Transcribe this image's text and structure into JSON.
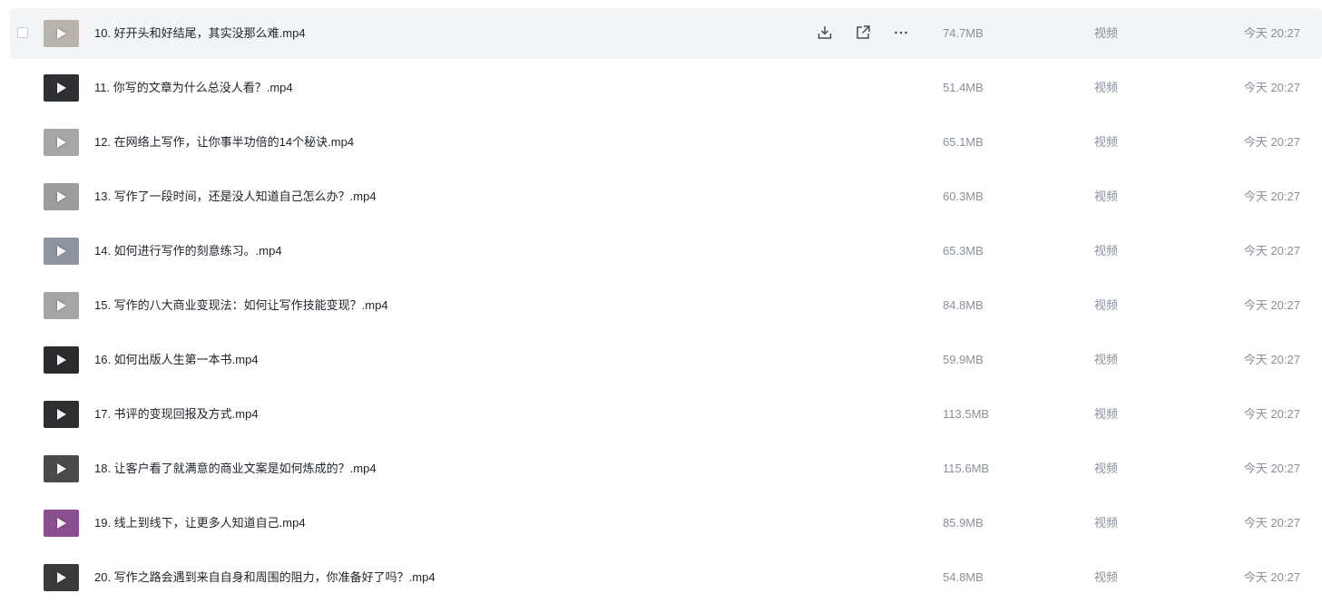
{
  "columns": {
    "type_label": "视频"
  },
  "row_actions": {
    "download_icon": "download-icon",
    "share_icon": "share-icon",
    "more_icon": "more-icon"
  },
  "files": [
    {
      "name": "10. 好开头和好结尾，其实没那么难.mp4",
      "size": "74.7MB",
      "type": "视频",
      "time": "今天 20:27",
      "thumb": "#b9b3ad"
    },
    {
      "name": "11. 你写的文章为什么总没人看？.mp4",
      "size": "51.4MB",
      "type": "视频",
      "time": "今天 20:27",
      "thumb": "#2f3033"
    },
    {
      "name": "12. 在网络上写作，让你事半功倍的14个秘诀.mp4",
      "size": "65.1MB",
      "type": "视频",
      "time": "今天 20:27",
      "thumb": "#a7a7a7"
    },
    {
      "name": "13. 写作了一段时间，还是没人知道自己怎么办？.mp4",
      "size": "60.3MB",
      "type": "视频",
      "time": "今天 20:27",
      "thumb": "#9c9c9c"
    },
    {
      "name": "14. 如何进行写作的刻意练习。.mp4",
      "size": "65.3MB",
      "type": "视频",
      "time": "今天 20:27",
      "thumb": "#8e95a0"
    },
    {
      "name": "15. 写作的八大商业变现法：如何让写作技能变现？.mp4",
      "size": "84.8MB",
      "type": "视频",
      "time": "今天 20:27",
      "thumb": "#a5a5a5"
    },
    {
      "name": "16. 如何出版人生第一本书.mp4",
      "size": "59.9MB",
      "type": "视频",
      "time": "今天 20:27",
      "thumb": "#2b2c2e"
    },
    {
      "name": "17. 书评的变现回报及方式.mp4",
      "size": "113.5MB",
      "type": "视频",
      "time": "今天 20:27",
      "thumb": "#2e2f31"
    },
    {
      "name": "18. 让客户看了就满意的商业文案是如何炼成的？.mp4",
      "size": "115.6MB",
      "type": "视频",
      "time": "今天 20:27",
      "thumb": "#4a4a4a"
    },
    {
      "name": "19. 线上到线下，让更多人知道自己.mp4",
      "size": "85.9MB",
      "type": "视频",
      "time": "今天 20:27",
      "thumb": "#8a4f8f"
    },
    {
      "name": "20. 写作之路会遇到来自自身和周围的阻力，你准备好了吗？.mp4",
      "size": "54.8MB",
      "type": "视频",
      "time": "今天 20:27",
      "thumb": "#3a3a3c"
    }
  ]
}
